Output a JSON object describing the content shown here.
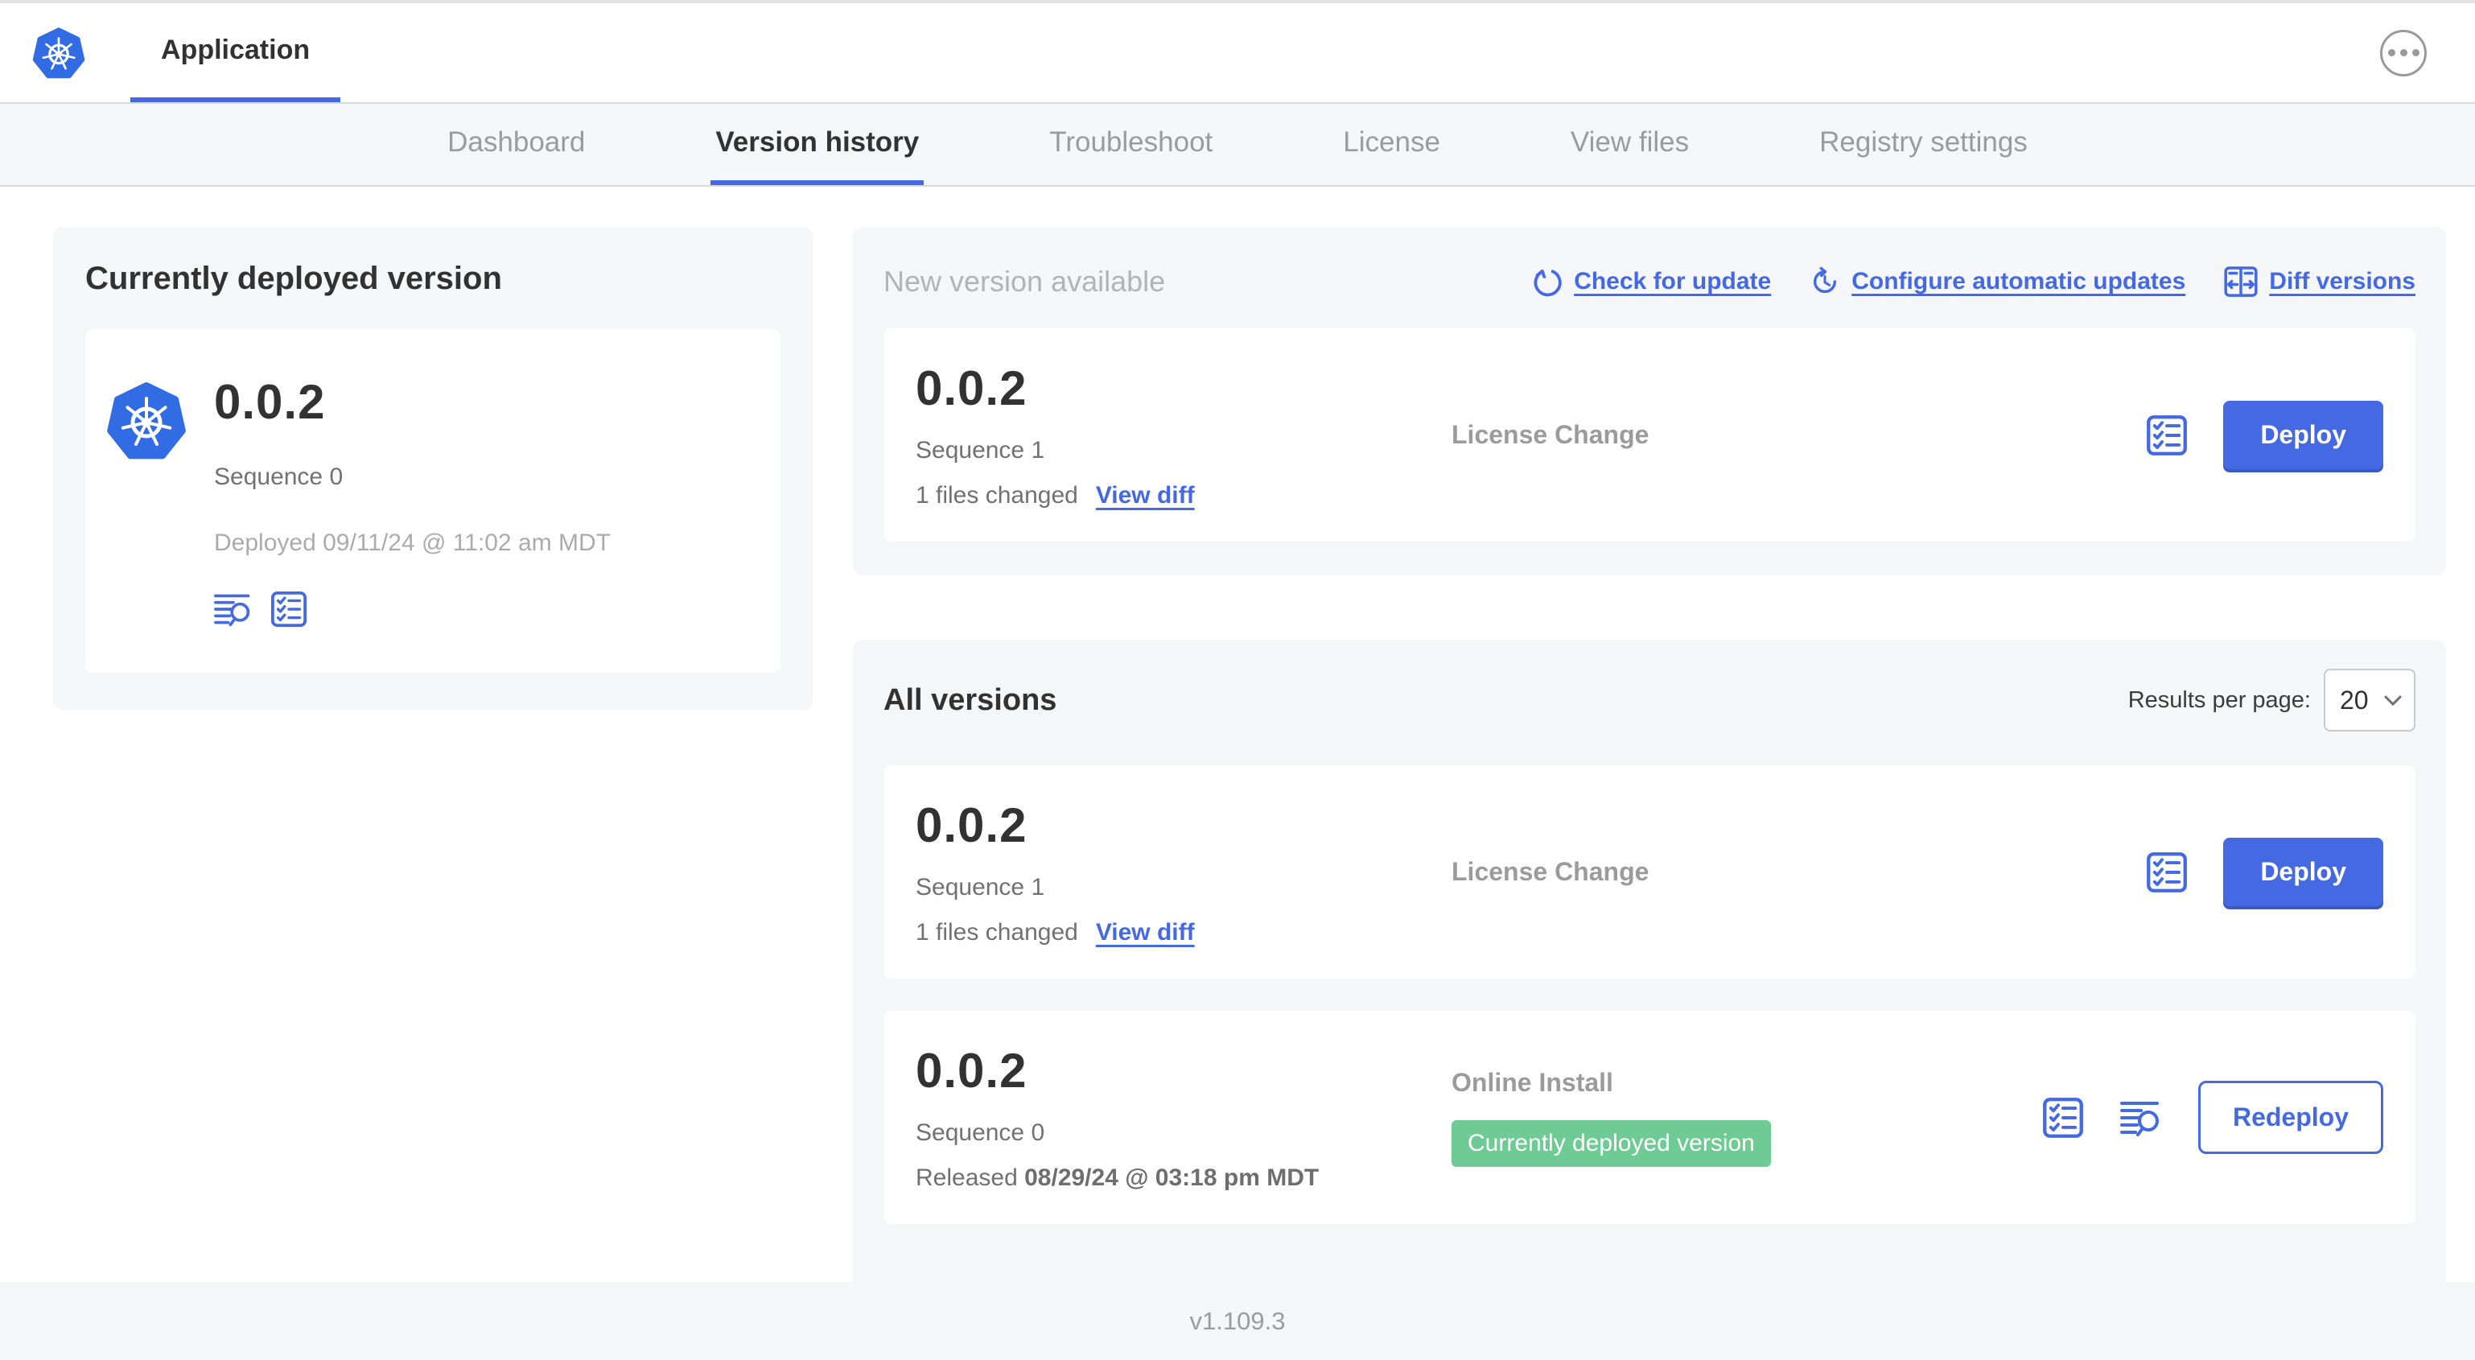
{
  "colors": {
    "accent_blue": "#4469E2",
    "kubernetes_blue": "#326CE5",
    "badge_green": "#6FCB94",
    "panel_gray": "#f4f6f8"
  },
  "header": {
    "app_tab_label": "Application"
  },
  "nav": {
    "tabs": [
      {
        "label": "Dashboard",
        "active": false
      },
      {
        "label": "Version history",
        "active": true
      },
      {
        "label": "Troubleshoot",
        "active": false
      },
      {
        "label": "License",
        "active": false
      },
      {
        "label": "View files",
        "active": false
      },
      {
        "label": "Registry settings",
        "active": false
      }
    ]
  },
  "current_deployed": {
    "title": "Currently deployed version",
    "version": "0.0.2",
    "sequence": "Sequence 0",
    "deployed": "Deployed 09/11/24 @ 11:02 am MDT"
  },
  "new_version": {
    "title": "New version available",
    "check_for_update_label": "Check for update",
    "configure_updates_label": "Configure automatic updates",
    "diff_versions_label": "Diff versions",
    "card": {
      "version": "0.0.2",
      "sequence": "Sequence 1",
      "files_changed": "1 files changed",
      "view_diff_label": "View diff",
      "source": "License Change",
      "action_label": "Deploy"
    }
  },
  "all_versions": {
    "title": "All versions",
    "results_per_page_label": "Results per page:",
    "results_per_page_value": "20",
    "rows": [
      {
        "version": "0.0.2",
        "sequence": "Sequence 1",
        "files_changed": "1 files changed",
        "view_diff_label": "View diff",
        "source": "License Change",
        "action_label": "Deploy"
      },
      {
        "version": "0.0.2",
        "sequence": "Sequence 0",
        "released_label": "Released",
        "released_date": "08/29/24 @ 03:18 pm MDT",
        "source": "Online Install",
        "badge": "Currently deployed version",
        "action_label": "Redeploy"
      }
    ]
  },
  "footer": {
    "version": "v1.109.3"
  }
}
